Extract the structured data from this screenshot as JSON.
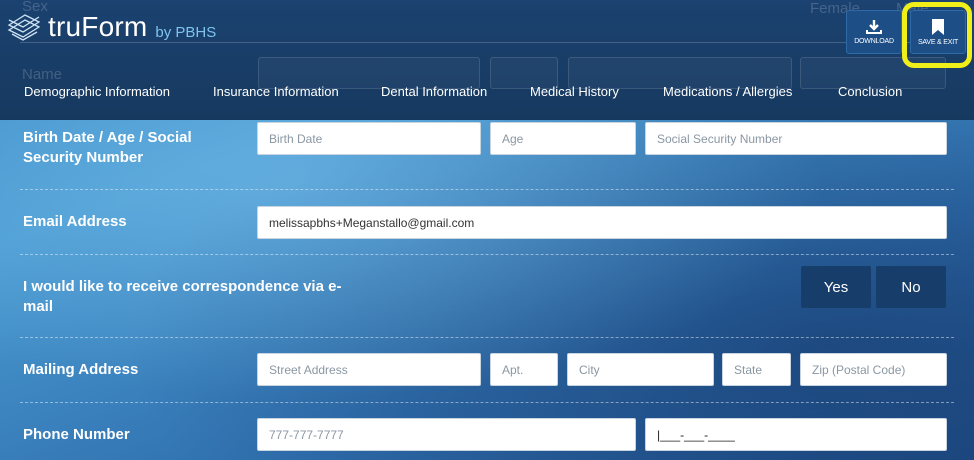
{
  "header": {
    "brand_name": "truForm",
    "brand_by": "by PBHS",
    "ghost_labels": {
      "sex": "Sex",
      "female": "Female",
      "male": "Male",
      "name": "Name"
    },
    "buttons": {
      "download": "DOWNLOAD",
      "save_exit": "SAVE & EXIT"
    }
  },
  "nav": {
    "items": [
      "Demographic Information",
      "Insurance Information",
      "Dental Information",
      "Medical History",
      "Medications / Allergies",
      "Conclusion"
    ]
  },
  "form": {
    "birth": {
      "label": "Birth Date / Age / Social Security Number",
      "birth_date_placeholder": "Birth Date",
      "age_placeholder": "Age",
      "ssn_placeholder": "Social Security Number"
    },
    "email": {
      "label": "Email Address",
      "value": "melissapbhs+Meganstallo@gmail.com"
    },
    "correspondence": {
      "label": "I would like to receive correspondence via e-mail",
      "yes": "Yes",
      "no": "No"
    },
    "mailing": {
      "label": "Mailing Address",
      "street_placeholder": "Street Address",
      "apt_placeholder": "Apt.",
      "city_placeholder": "City",
      "state_placeholder": "State",
      "zip_placeholder": "Zip (Postal Code)"
    },
    "phone": {
      "label": "Phone Number",
      "placeholder": "777-777-7777",
      "second_value": "|___-___-____"
    }
  },
  "colors": {
    "header_bg": "#173d6b",
    "button_bg": "#1d4f86",
    "highlight": "#f1ef1a",
    "brand_by": "#7fc3ef"
  },
  "icons": {
    "logo": "truform-logo-icon",
    "download": "download-icon",
    "save": "bookmark-icon"
  }
}
